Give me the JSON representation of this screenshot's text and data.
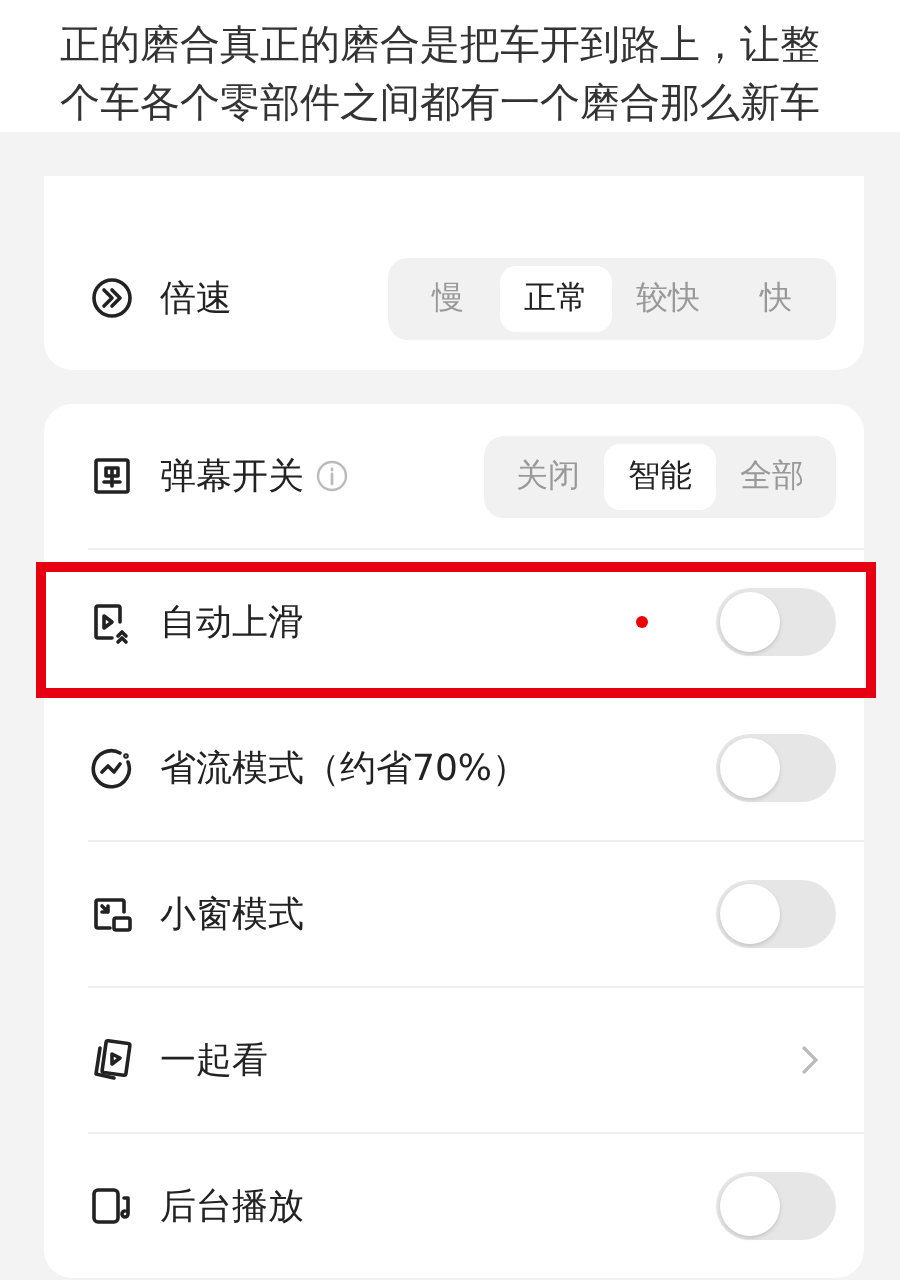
{
  "article": {
    "lines": [
      "正的磨合真正的磨合是把车开到路上，让整",
      "个车各个零部件之间都有一个磨合那么新车"
    ]
  },
  "cards": [
    {
      "rows": [
        {
          "kind": "segmented",
          "label": "倍速",
          "options": [
            {
              "label": "慢",
              "selected": false
            },
            {
              "label": "正常",
              "selected": true
            },
            {
              "label": "较快",
              "selected": false
            },
            {
              "label": "快",
              "selected": false
            }
          ]
        }
      ]
    },
    {
      "rows": [
        {
          "kind": "segmented",
          "label": "弹幕开关",
          "info": true,
          "options": [
            {
              "label": "关闭",
              "selected": false
            },
            {
              "label": "智能",
              "selected": true
            },
            {
              "label": "全部",
              "selected": false
            }
          ]
        },
        {
          "kind": "toggle",
          "label": "自动上滑",
          "on": false,
          "highlighted": true
        },
        {
          "kind": "toggle",
          "label": "省流模式（约省70%）",
          "on": false
        },
        {
          "kind": "toggle",
          "label": "小窗模式",
          "on": false
        },
        {
          "kind": "link",
          "label": "一起看"
        },
        {
          "kind": "toggle",
          "label": "后台播放",
          "on": false
        }
      ]
    }
  ]
}
